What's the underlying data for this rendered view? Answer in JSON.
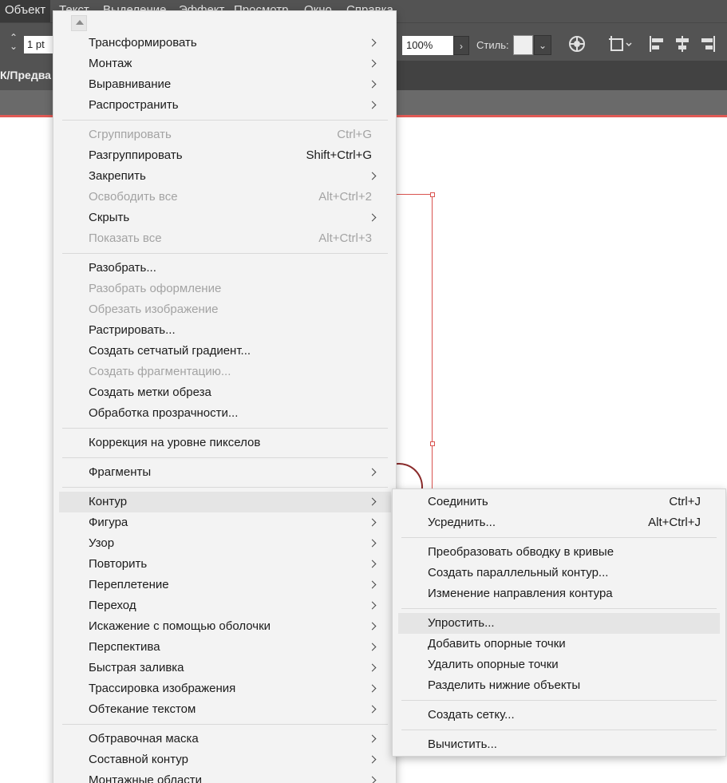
{
  "menubar": {
    "items": [
      "Объект",
      "Текст",
      "Выделение",
      "Эффект",
      "Просмотр",
      "Окно",
      "Справка"
    ],
    "active": "Объект"
  },
  "control_bar": {
    "stroke_value": "1 pt",
    "zoom_value": "100%",
    "style_label": "Стиль:",
    "icons": [
      "stroke-spinner-icon",
      "zoom-dropdown-icon",
      "style-dropdown-icon",
      "recolor-icon",
      "artboard-align-icon",
      "align-left-icon",
      "align-center-icon",
      "align-right-icon"
    ]
  },
  "document_tab": {
    "label": "К/Предва"
  },
  "colors": {
    "menu_bg": "#f3f3f3",
    "menu_highlight": "#e5e5e5",
    "disabled_text": "#a3a3a3",
    "app_chrome": "#535353",
    "artboard_edge": "#e05a55"
  },
  "object_menu": {
    "groups": [
      [
        {
          "label": "Трансформировать",
          "submenu": true
        },
        {
          "label": "Монтаж",
          "submenu": true
        },
        {
          "label": "Выравнивание",
          "submenu": true
        },
        {
          "label": "Распространить",
          "submenu": true
        }
      ],
      [
        {
          "label": "Сгруппировать",
          "shortcut": "Ctrl+G",
          "disabled": true
        },
        {
          "label": "Разгруппировать",
          "shortcut": "Shift+Ctrl+G"
        },
        {
          "label": "Закрепить",
          "submenu": true
        },
        {
          "label": "Освободить все",
          "shortcut": "Alt+Ctrl+2",
          "disabled": true
        },
        {
          "label": "Скрыть",
          "submenu": true
        },
        {
          "label": "Показать все",
          "shortcut": "Alt+Ctrl+3",
          "disabled": true
        }
      ],
      [
        {
          "label": "Разобрать..."
        },
        {
          "label": "Разобрать оформление",
          "disabled": true
        },
        {
          "label": "Обрезать изображение",
          "disabled": true
        },
        {
          "label": "Растрировать..."
        },
        {
          "label": "Создать сетчатый градиент..."
        },
        {
          "label": "Создать фрагментацию...",
          "disabled": true
        },
        {
          "label": "Создать метки обреза"
        },
        {
          "label": "Обработка прозрачности..."
        }
      ],
      [
        {
          "label": "Коррекция на уровне пикселов"
        }
      ],
      [
        {
          "label": "Фрагменты",
          "submenu": true
        }
      ],
      [
        {
          "label": "Контур",
          "submenu": true,
          "highlighted": true
        },
        {
          "label": "Фигура",
          "submenu": true
        },
        {
          "label": "Узор",
          "submenu": true
        },
        {
          "label": "Повторить",
          "submenu": true
        },
        {
          "label": "Переплетение",
          "submenu": true
        },
        {
          "label": "Переход",
          "submenu": true
        },
        {
          "label": "Искажение с помощью оболочки",
          "submenu": true
        },
        {
          "label": "Перспектива",
          "submenu": true
        },
        {
          "label": "Быстрая заливка",
          "submenu": true
        },
        {
          "label": "Трассировка изображения",
          "submenu": true
        },
        {
          "label": "Обтекание текстом",
          "submenu": true
        }
      ],
      [
        {
          "label": "Обтравочная маска",
          "submenu": true
        },
        {
          "label": "Составной контур",
          "submenu": true
        },
        {
          "label": "Монтажные области",
          "submenu": true
        }
      ]
    ]
  },
  "path_submenu": {
    "groups": [
      [
        {
          "label": "Соединить",
          "shortcut": "Ctrl+J"
        },
        {
          "label": "Усреднить...",
          "shortcut": "Alt+Ctrl+J"
        }
      ],
      [
        {
          "label": "Преобразовать обводку в кривые"
        },
        {
          "label": "Создать параллельный контур..."
        },
        {
          "label": "Изменение направления контура"
        }
      ],
      [
        {
          "label": "Упростить...",
          "highlighted": true
        },
        {
          "label": "Добавить опорные точки"
        },
        {
          "label": "Удалить опорные точки"
        },
        {
          "label": "Разделить нижние объекты"
        }
      ],
      [
        {
          "label": "Создать сетку..."
        }
      ],
      [
        {
          "label": "Вычистить..."
        }
      ]
    ]
  }
}
